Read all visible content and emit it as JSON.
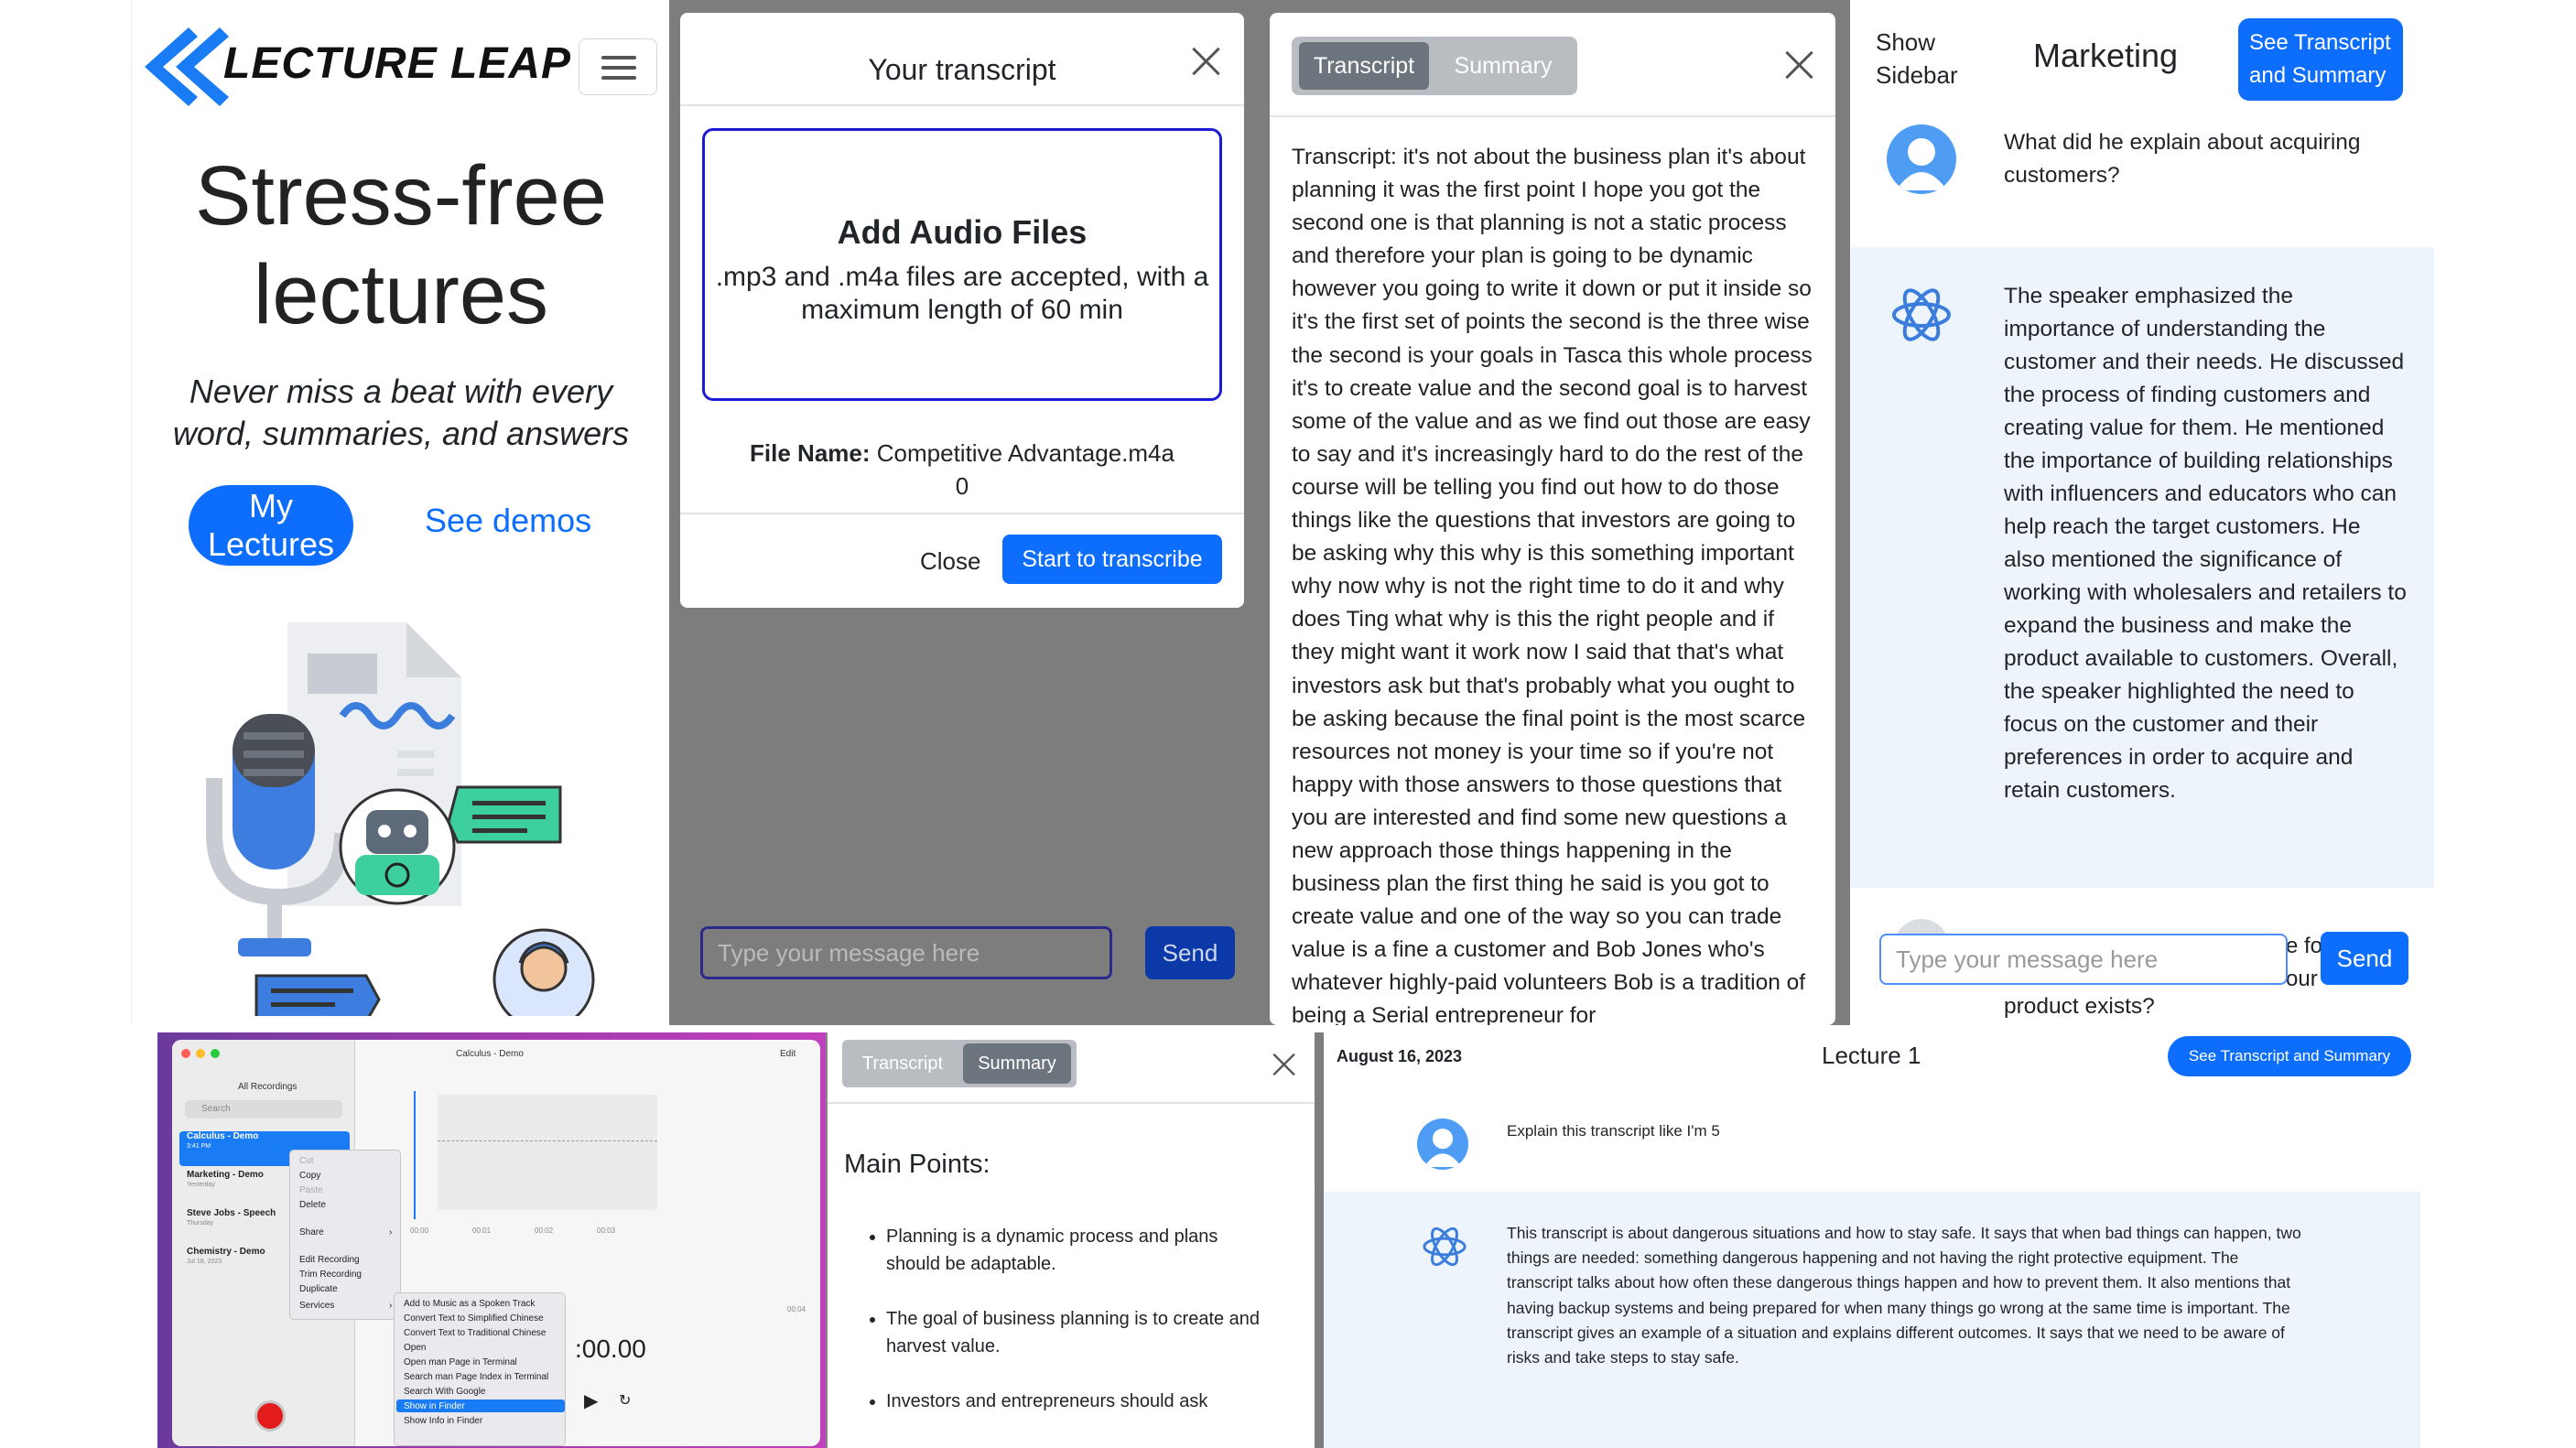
{
  "landing": {
    "logo_text": "LECTURE LEAP",
    "hero_line1": "Stress-free",
    "hero_line2": "lectures",
    "tagline": "Never miss a beat with every word, summaries, and answers",
    "my_lectures": "My Lectures",
    "see_demos": "See demos"
  },
  "upload_modal": {
    "title": "Your transcript",
    "dropzone_title": "Add Audio Files",
    "dropzone_desc": ".mp3 and .m4a files are accepted, with a maximum length of 60 min",
    "file_name_label": "File Name:",
    "file_name": "Competitive Advantage.m4a",
    "progress": "0",
    "close_label": "Close",
    "start_label": "Start to transcribe",
    "message_placeholder": "Type your message here",
    "send_label": "Send"
  },
  "transcript_modal": {
    "tab_transcript": "Transcript",
    "tab_summary": "Summary",
    "text": "Transcript: it's not about the business plan it's about planning it was the first point I hope you got the second one is that planning is not a static process and therefore your plan is going to be dynamic however you going to write it down or put it inside so it's the first set of points the second is the three wise the second is your goals in Tasca this whole process it's to create value and the second goal is to harvest some of the value and as we find out those are easy to say and it's increasingly hard to do the rest of the course will be telling you find out how to do those things like the questions that investors are going to be asking why this why is this something important why now why is not the right time to do it and why does Ting what why is this the right people and if they might want it work now I said that that's what investors ask but that's probably what you ought to be asking because the final point is the most scarce resources not money is your time so if you're not happy with those answers to those questions that you are interested and find some new questions a new approach those things happening in the business plan the first thing he said is you got to create value and one of the way so you can trade value is a fine a customer and Bob Jones who's whatever highly-paid volunteers Bob is a tradition of being a Serial entrepreneur for"
  },
  "chat": {
    "show_sidebar": "Show Sidebar",
    "lecture_title": "Marketing",
    "see_ts_label": "See Transcript and Summary",
    "question": "What did he explain about acquiring customers?",
    "answer": "The speaker emphasized the importance of understanding the customer and their needs. He discussed the process of finding customers and creating value for them. He mentioned the importance of building relationships with influencers and educators who can help reach the target customers. He also mentioned the significance of working with wholesalers and retailers to expand the business and make the product available to customers. Overall, the speaker highlighted the need to focus on the customer and their preferences in order to acquire and retain customers.",
    "placeholder": "Type your message here",
    "send_label": "Send",
    "partial_fragment_1": "e fo",
    "partial_fragment_2": "our",
    "partial_line": "product exists?"
  },
  "voice_memos": {
    "window_title": "Calculus - Demo",
    "edit_label": "Edit",
    "all_recordings": "All Recordings",
    "search_placeholder": "Search",
    "recordings": [
      {
        "title": "Calculus - Demo",
        "date": "3:41 PM"
      },
      {
        "title": "Marketing - Demo",
        "date": "Yesterday"
      },
      {
        "title": "Steve Jobs - Speech",
        "date": "Thursday"
      },
      {
        "title": "Chemistry - Demo",
        "date": "Jul 18, 2023"
      }
    ],
    "context_menu": [
      "Cut",
      "Copy",
      "Paste",
      "Delete",
      "Share",
      "Edit Recording",
      "Trim Recording",
      "Duplicate",
      "Services"
    ],
    "services_menu": [
      "Add to Music as a Spoken Track",
      "Convert Text to Simplified Chinese",
      "Convert Text to Traditional Chinese",
      "Open",
      "Open man Page in Terminal",
      "Search man Page Index in Terminal",
      "Search With Google",
      "Show in Finder",
      "Show Info in Finder"
    ],
    "ticks": [
      "00:00",
      "00:01",
      "00:02",
      "00:03",
      "00:04"
    ],
    "time": ":00.00"
  },
  "summary_modal": {
    "tab_transcript": "Transcript",
    "tab_summary": "Summary",
    "heading": "Main Points:",
    "points": [
      "Planning is a dynamic process and plans should be adaptable.",
      "The goal of business planning is to create and harvest value.",
      "Investors and entrepreneurs should ask"
    ]
  },
  "lecture1": {
    "date": "August 16, 2023",
    "title": "Lecture 1",
    "see_ts_label": "See Transcript and Summary",
    "question": "Explain this transcript like I'm 5",
    "answer": "This transcript is about dangerous situations and how to stay safe. It says that when bad things can happen, two things are needed: something dangerous happening and not having the right protective equipment. The transcript talks about how often these dangerous things happen and how to prevent them. It also mentions that having backup systems and being prepared for when many things go wrong at the same time is important. The transcript gives an example of a situation and explains different outcomes. It says that we need to be aware of risks and take steps to stay safe."
  },
  "colors": {
    "primary": "#0d6efd",
    "overlay": "#7d7d7d",
    "answer_bg": "#eef4fb"
  }
}
